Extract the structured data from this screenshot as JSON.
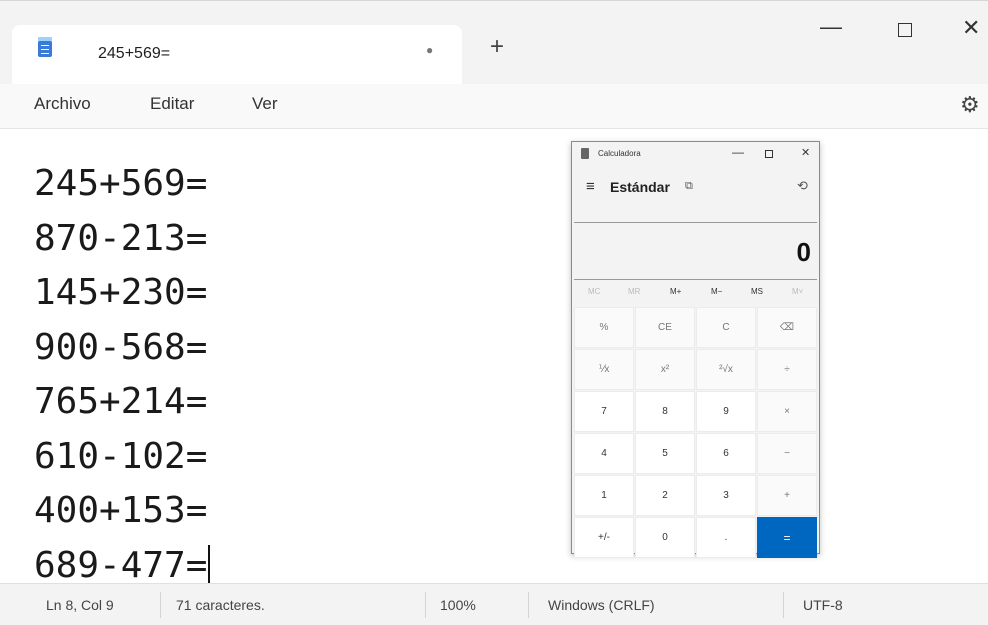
{
  "notepad": {
    "tab_title": "245+569=",
    "tab_modified_dot": "●",
    "new_tab_symbol": "+",
    "window_controls": {
      "minimize": "—",
      "close": "✕"
    },
    "menu": [
      "Archivo",
      "Editar",
      "Ver"
    ],
    "settings_icon": "⚙",
    "lines": [
      "245+569=",
      "870-213=",
      "145+230=",
      "900-568=",
      "765+214=",
      "610-102=",
      "400+153=",
      "689-477="
    ]
  },
  "calculator": {
    "title": "Calculadora",
    "menu_icon": "≡",
    "mode": "Estándar",
    "keep_on_top_icon": "⧉",
    "history_icon": "⟲",
    "window_controls": {
      "minimize": "—",
      "close": "✕"
    },
    "display": "0",
    "memory": [
      "MC",
      "MR",
      "M+",
      "M−",
      "MS",
      "M˅"
    ],
    "keys": [
      [
        "%",
        "CE",
        "C",
        "⌫"
      ],
      [
        "⅟x",
        "x²",
        "²√x",
        "÷"
      ],
      [
        "7",
        "8",
        "9",
        "×"
      ],
      [
        "4",
        "5",
        "6",
        "−"
      ],
      [
        "1",
        "2",
        "3",
        "+"
      ],
      [
        "+/-",
        "0",
        ".",
        "="
      ]
    ]
  },
  "status": {
    "position": "Ln 8, Col 9",
    "chars": "71 caracteres.",
    "zoom": "100%",
    "line_ending": "Windows (CRLF)",
    "encoding": "UTF-8"
  }
}
